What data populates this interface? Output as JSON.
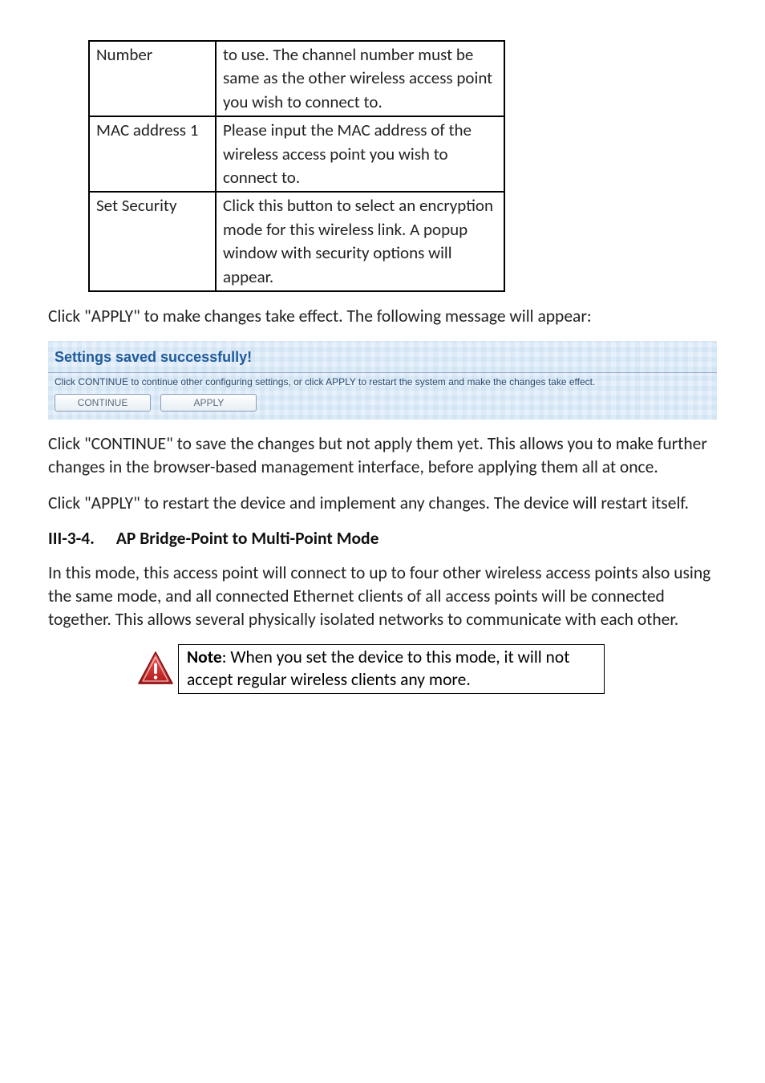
{
  "table": {
    "rows": [
      {
        "label": "Number",
        "desc": "to use. The channel number must be same as the other wireless access point you wish to connect to."
      },
      {
        "label": "MAC address 1",
        "desc": "Please input the MAC address of the wireless access point you wish to connect to."
      },
      {
        "label": "Set Security",
        "desc": "Click this button to select an encryption mode for this wireless link. A popup window with security options will appear."
      }
    ]
  },
  "p_apply_before": "Click \"APPLY\" to make changes take effect. The following message will appear:",
  "settings": {
    "title": "Settings saved successfully!",
    "hint": "Click CONTINUE to continue other configuring settings, or click APPLY to restart the system and make the changes take effect.",
    "continue_label": "CONTINUE",
    "apply_label": "APPLY"
  },
  "p_continue": "Click \"CONTINUE\" to save the changes but not apply them yet. This allows you to make further changes in the browser-based management interface, before applying them all at once.",
  "p_apply_after": "Click \"APPLY\" to restart the device and implement any changes. The device will restart itself.",
  "heading": {
    "number": "III-3-4.",
    "title": "AP Bridge-Point to Multi-Point Mode"
  },
  "p_mode_desc": "In this mode, this access point will connect to up to four other wireless access points also using the same mode, and all connected Ethernet clients of all access points will be connected together. This allows several physically isolated networks to communicate with each other.",
  "note": {
    "label": "Note",
    "text": ": When you set the device to this mode, it will not accept regular wireless clients any more."
  }
}
